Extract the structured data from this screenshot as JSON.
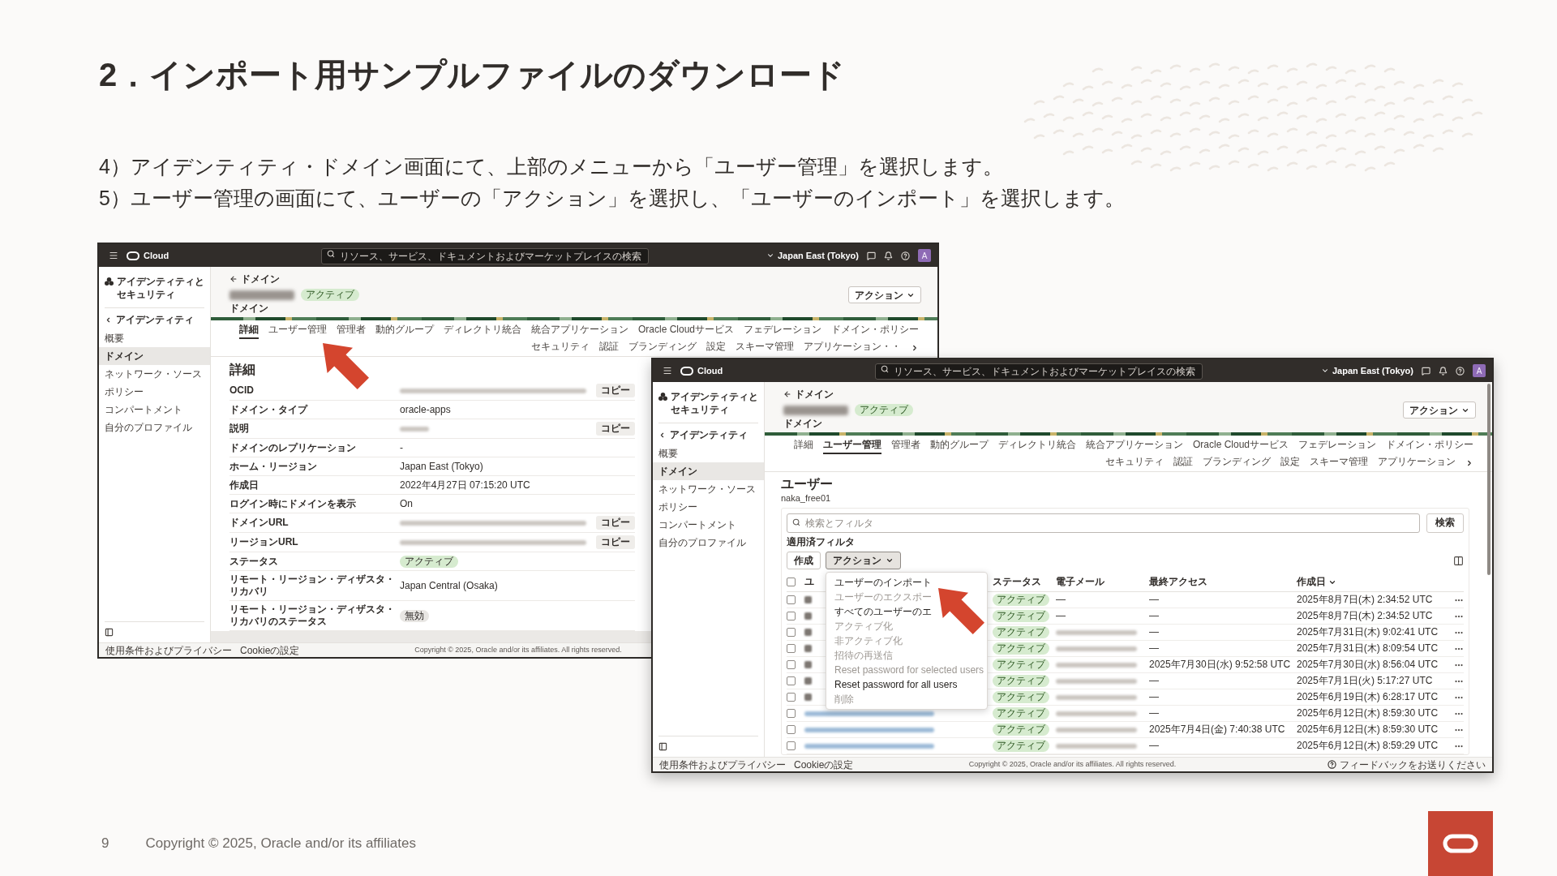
{
  "slide": {
    "title": "2．インポート用サンプルファイルのダウンロード",
    "instructions": [
      "4）アイデンティティ・ドメイン画面にて、上部のメニューから「ユーザー管理」を選択します。",
      "5）ユーザー管理の画面にて、ユーザーの「アクション」を選択し、「ユーザーのインポート」を選択します。"
    ]
  },
  "screenshots": [
    {
      "kind": "domain_details",
      "top_bar": {
        "brand": "Cloud",
        "search_placeholder": "リソース、サービス、ドキュメントおよびマーケットプレイスの検索",
        "region": "Japan East (Tokyo)",
        "avatar": "A"
      },
      "sidebar": {
        "title": "アイデンティティとセキュリティ",
        "back_link": "アイデンティティ",
        "items": [
          {
            "label": "概要",
            "selected": false
          },
          {
            "label": "ドメイン",
            "selected": true
          },
          {
            "label": "ネットワーク・ソース",
            "selected": false
          },
          {
            "label": "ポリシー",
            "selected": false
          },
          {
            "label": "コンパートメント",
            "selected": false
          },
          {
            "label": "自分のプロファイル",
            "selected": false
          }
        ]
      },
      "header": {
        "breadcrumb": "ドメイン",
        "status_badge": "アクティブ",
        "subtitle": "ドメイン",
        "action_button": "アクション"
      },
      "tabs": [
        {
          "label": "詳細",
          "selected": true
        },
        {
          "label": "ユーザー管理",
          "selected": false
        },
        {
          "label": "管理者",
          "selected": false
        },
        {
          "label": "動的グループ",
          "selected": false
        },
        {
          "label": "ディレクトリ統合",
          "selected": false
        },
        {
          "label": "統合アプリケーション",
          "selected": false
        },
        {
          "label": "Oracle Cloudサービス",
          "selected": false
        },
        {
          "label": "フェデレーション",
          "selected": false
        },
        {
          "label": "ドメイン・ポリシー",
          "selected": false
        },
        {
          "label": "セキュリティ",
          "selected": false
        },
        {
          "label": "認証",
          "selected": false
        },
        {
          "label": "ブランディング",
          "selected": false
        },
        {
          "label": "設定",
          "selected": false
        },
        {
          "label": "スキーマ管理",
          "selected": false
        },
        {
          "label": "アプリケーション・・",
          "selected": false
        }
      ],
      "details": {
        "heading": "詳細",
        "rows": [
          {
            "label": "OCID",
            "kind": "blurred_long",
            "copy": "コピー"
          },
          {
            "label": "ドメイン・タイプ",
            "kind": "text",
            "value": "oracle-apps"
          },
          {
            "label": "説明",
            "kind": "blurred_short",
            "copy": "コピー"
          },
          {
            "label": "ドメインのレプリケーション",
            "kind": "text",
            "value": "-"
          },
          {
            "label": "ホーム・リージョン",
            "kind": "text",
            "value": "Japan East (Tokyo)"
          },
          {
            "label": "作成日",
            "kind": "text",
            "value": "2022年4月27日 07:15:20 UTC"
          },
          {
            "label": "ログイン時にドメインを表示",
            "kind": "text",
            "value": "On"
          },
          {
            "label": "ドメインURL",
            "kind": "blurred_long",
            "copy": "コピー"
          },
          {
            "label": "リージョンURL",
            "kind": "blurred_long",
            "copy": "コピー"
          },
          {
            "label": "ステータス",
            "kind": "badge",
            "value": "アクティブ",
            "color": "#d6ebcf"
          },
          {
            "label": "リモート・リージョン・ディザスタ・リカバリ",
            "kind": "text",
            "value": "Japan Central (Osaka)"
          },
          {
            "label": "リモート・リージョン・ディザスタ・リカバリのステータス",
            "kind": "badge",
            "value": "無効",
            "color": "#e8e6e3"
          }
        ]
      },
      "footer": {
        "links": [
          "使用条件およびプライバシー",
          "Cookieの設定"
        ],
        "copyright": "Copyright © 2025, Oracle and/or its affiliates. All rights reserved."
      }
    },
    {
      "kind": "users",
      "top_bar": {
        "brand": "Cloud",
        "search_placeholder": "リソース、サービス、ドキュメントおよびマーケットプレイスの検索",
        "region": "Japan East (Tokyo)",
        "avatar": "A"
      },
      "sidebar": {
        "title": "アイデンティティとセキュリティ",
        "back_link": "アイデンティティ",
        "items": [
          {
            "label": "概要",
            "selected": false
          },
          {
            "label": "ドメイン",
            "selected": true
          },
          {
            "label": "ネットワーク・ソース",
            "selected": false
          },
          {
            "label": "ポリシー",
            "selected": false
          },
          {
            "label": "コンパートメント",
            "selected": false
          },
          {
            "label": "自分のプロファイル",
            "selected": false
          }
        ]
      },
      "header": {
        "breadcrumb": "ドメイン",
        "status_badge": "アクティブ",
        "subtitle": "ドメイン",
        "action_button": "アクション"
      },
      "tabs": [
        {
          "label": "詳細",
          "selected": false
        },
        {
          "label": "ユーザー管理",
          "selected": true
        },
        {
          "label": "管理者",
          "selected": false
        },
        {
          "label": "動的グループ",
          "selected": false
        },
        {
          "label": "ディレクトリ統合",
          "selected": false
        },
        {
          "label": "統合アプリケーション",
          "selected": false
        },
        {
          "label": "Oracle Cloudサービス",
          "selected": false
        },
        {
          "label": "フェデレーション",
          "selected": false
        },
        {
          "label": "ドメイン・ポリシー",
          "selected": false
        },
        {
          "label": "セキュリティ",
          "selected": false
        },
        {
          "label": "認証",
          "selected": false
        },
        {
          "label": "ブランディング",
          "selected": false
        },
        {
          "label": "設定",
          "selected": false
        },
        {
          "label": "スキーマ管理",
          "selected": false
        },
        {
          "label": "アプリケーション",
          "selected": false
        }
      ],
      "users": {
        "heading": "ユーザー",
        "subheading": "naka_free01",
        "search": {
          "placeholder": "検索とフィルタ",
          "button": "検索"
        },
        "filters_label": "適用済フィルタ",
        "buttons": [
          {
            "label": "作成",
            "kind": "button"
          },
          {
            "label": "アクション",
            "kind": "menu_button",
            "expanded": true,
            "menu": [
              {
                "label": "ユーザーのインポート",
                "disabled": false
              },
              {
                "label": "ユーザーのエクスポー",
                "disabled": true
              },
              {
                "label": "すべてのユーザーのエ",
                "disabled": false
              },
              {
                "label": "アクティブ化",
                "disabled": true
              },
              {
                "label": "非アクティブ化",
                "disabled": true
              },
              {
                "label": "招待の再送信",
                "disabled": true
              },
              {
                "label": "Reset password for selected users",
                "disabled": true
              },
              {
                "label": "Reset password for all users",
                "disabled": false
              },
              {
                "label": "削除",
                "disabled": true
              }
            ]
          }
        ],
        "table": {
          "select_all": {
            "checked": false
          },
          "columns": [
            {
              "label": "ユ",
              "sorted": false
            },
            {
              "label": "ステータス",
              "sorted": false
            },
            {
              "label": "電子メール",
              "sorted": false
            },
            {
              "label": "最終アクセス",
              "sorted": false
            },
            {
              "label": "作成日",
              "sorted": true
            }
          ],
          "rows": [
            {
              "checked": false,
              "name": {
                "kind": "blurred_initial"
              },
              "status": "アクティブ",
              "email": {
                "kind": "text",
                "value": "—"
              },
              "last_access": "—",
              "created": "2025年8月7日(木) 2:34:52 UTC"
            },
            {
              "checked": false,
              "name": {
                "kind": "blurred_initial"
              },
              "status": "アクティブ",
              "email": {
                "kind": "text",
                "value": "—"
              },
              "last_access": "—",
              "created": "2025年8月7日(木) 2:34:52 UTC"
            },
            {
              "checked": false,
              "name": {
                "kind": "blurred_initial"
              },
              "status": "アクティブ",
              "email": {
                "kind": "blurred"
              },
              "last_access": "—",
              "created": "2025年7月31日(木) 9:02:41 UTC"
            },
            {
              "checked": false,
              "name": {
                "kind": "blurred_initial"
              },
              "status": "アクティブ",
              "email": {
                "kind": "blurred"
              },
              "last_access": "—",
              "created": "2025年7月31日(木) 8:09:54 UTC"
            },
            {
              "checked": false,
              "name": {
                "kind": "blurred_initial"
              },
              "status": "アクティブ",
              "email": {
                "kind": "blurred"
              },
              "last_access": "2025年7月30日(水) 9:52:58 UTC",
              "created": "2025年7月30日(水) 8:56:04 UTC"
            },
            {
              "checked": false,
              "name": {
                "kind": "blurred_initial"
              },
              "status": "アクティブ",
              "email": {
                "kind": "blurred"
              },
              "last_access": "—",
              "created": "2025年7月1日(火) 5:17:27 UTC"
            },
            {
              "checked": false,
              "name": {
                "kind": "blurred_initial"
              },
              "status": "アクティブ",
              "email": {
                "kind": "blurred"
              },
              "last_access": "—",
              "created": "2025年6月19日(木) 6:28:17 UTC"
            },
            {
              "checked": false,
              "name": {
                "kind": "blurred_link"
              },
              "status": "アクティブ",
              "email": {
                "kind": "blurred"
              },
              "last_access": "—",
              "created": "2025年6月12日(木) 8:59:30 UTC"
            },
            {
              "checked": false,
              "name": {
                "kind": "blurred_link"
              },
              "status": "アクティブ",
              "email": {
                "kind": "blurred"
              },
              "last_access": "2025年7月4日(金) 7:40:38 UTC",
              "created": "2025年6月12日(木) 8:59:30 UTC"
            },
            {
              "checked": false,
              "name": {
                "kind": "blurred_link"
              },
              "status": "アクティブ",
              "email": {
                "kind": "blurred"
              },
              "last_access": "—",
              "created": "2025年6月12日(木) 8:59:29 UTC"
            }
          ]
        }
      },
      "footer": {
        "links": [
          "使用条件およびプライバシー",
          "Cookieの設定"
        ],
        "copyright": "Copyright © 2025, Oracle and/or its affiliates. All rights reserved.",
        "feedback": "フィードバックをお送りください"
      }
    }
  ],
  "footer": {
    "page_number": "9",
    "copyright": "Copyright © 2025, Oracle and/or its affiliates"
  }
}
